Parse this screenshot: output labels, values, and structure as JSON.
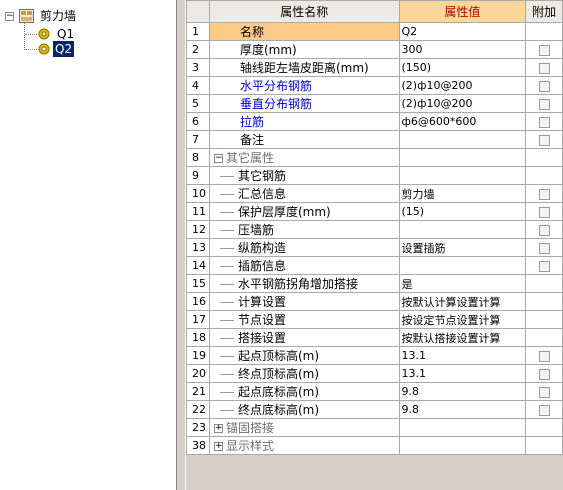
{
  "tree": {
    "root_label": "剪力墙",
    "root_toggle": "−",
    "children": [
      {
        "label": "Q1",
        "selected": false
      },
      {
        "label": "Q2",
        "selected": true
      }
    ]
  },
  "grid": {
    "headers": {
      "name": "属性名称",
      "value": "属性值",
      "add": "附加"
    },
    "rows": [
      {
        "num": "1",
        "name": "名称",
        "value": "Q2",
        "style": "current",
        "checkbox": false
      },
      {
        "num": "2",
        "name": "厚度(mm)",
        "value": "300",
        "style": "normal",
        "checkbox": true
      },
      {
        "num": "3",
        "name": "轴线距左墙皮距离(mm)",
        "value": "(150)",
        "style": "normal",
        "checkbox": true
      },
      {
        "num": "4",
        "name": "水平分布钢筋",
        "value": "(2)ф10@200",
        "style": "blue",
        "checkbox": true
      },
      {
        "num": "5",
        "name": "垂直分布钢筋",
        "value": "(2)ф10@200",
        "style": "blue",
        "checkbox": true
      },
      {
        "num": "6",
        "name": "拉筋",
        "value": "ф6@600*600",
        "style": "blue",
        "checkbox": true
      },
      {
        "num": "7",
        "name": "备注",
        "value": "",
        "style": "normal",
        "checkbox": true
      },
      {
        "num": "8",
        "name": "其它属性",
        "value": "",
        "style": "group",
        "toggle": "−",
        "checkbox": false
      },
      {
        "num": "9",
        "name": "其它钢筋",
        "value": "",
        "style": "child",
        "checkbox": false
      },
      {
        "num": "10",
        "name": "汇总信息",
        "value": "剪力墙",
        "style": "child",
        "checkbox": true
      },
      {
        "num": "11",
        "name": "保护层厚度(mm)",
        "value": "(15)",
        "style": "child",
        "checkbox": true
      },
      {
        "num": "12",
        "name": "压墙筋",
        "value": "",
        "style": "child",
        "checkbox": true
      },
      {
        "num": "13",
        "name": "纵筋构造",
        "value": "设置插筋",
        "style": "child",
        "checkbox": true
      },
      {
        "num": "14",
        "name": "插筋信息",
        "value": "",
        "style": "child",
        "checkbox": true
      },
      {
        "num": "15",
        "name": "水平钢筋拐角增加搭接",
        "value": "是",
        "style": "child",
        "checkbox": false
      },
      {
        "num": "16",
        "name": "计算设置",
        "value": "按默认计算设置计算",
        "style": "child",
        "checkbox": false
      },
      {
        "num": "17",
        "name": "节点设置",
        "value": "按设定节点设置计算",
        "style": "child",
        "checkbox": false
      },
      {
        "num": "18",
        "name": "搭接设置",
        "value": "按默认搭接设置计算",
        "style": "child",
        "checkbox": false
      },
      {
        "num": "19",
        "name": "起点顶标高(m)",
        "value": "13.1",
        "style": "child",
        "checkbox": true
      },
      {
        "num": "20",
        "name": "终点顶标高(m)",
        "value": "13.1",
        "style": "child",
        "checkbox": true
      },
      {
        "num": "21",
        "name": "起点底标高(m)",
        "value": "9.8",
        "style": "child",
        "checkbox": true
      },
      {
        "num": "22",
        "name": "终点底标高(m)",
        "value": "9.8",
        "style": "child",
        "checkbox": true
      },
      {
        "num": "23",
        "name": "锚固搭接",
        "value": "",
        "style": "group",
        "toggle": "+",
        "checkbox": false
      },
      {
        "num": "38",
        "name": "显示样式",
        "value": "",
        "style": "group",
        "toggle": "+",
        "checkbox": false
      }
    ]
  },
  "colors": {
    "header_value_bg": "#fdd798",
    "header_value_text": "#b00000",
    "current_row": "#ffcc88",
    "blue_text": "#0000c8",
    "selection": "#0a246a"
  }
}
